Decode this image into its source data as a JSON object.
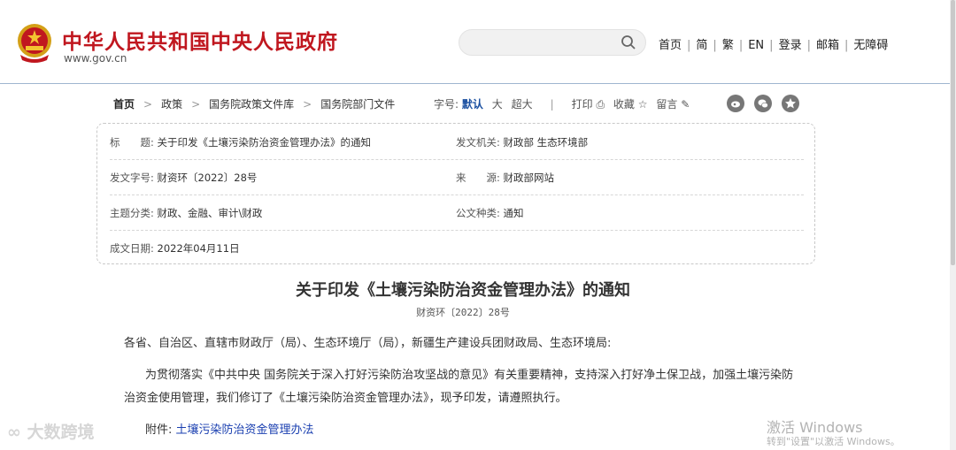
{
  "header": {
    "site_title": "中华人民共和国中央人民政府",
    "site_url": "www.gov.cn",
    "search_placeholder": "",
    "nav": [
      "首页",
      "简",
      "繁",
      "EN",
      "登录",
      "邮箱",
      "无障碍"
    ]
  },
  "breadcrumb": [
    "首页",
    "政策",
    "国务院政策文件库",
    "国务院部门文件"
  ],
  "tools": {
    "font_label": "字号:",
    "font_default": "默认",
    "font_large": "大",
    "font_xlarge": "超大",
    "print": "打印",
    "favorite": "收藏",
    "comment": "留言"
  },
  "info": {
    "title_label": "标　　题:",
    "title_value": "关于印发《土壤污染防治资金管理办法》的通知",
    "issuer_label": "发文机关:",
    "issuer_value": "财政部 生态环境部",
    "docno_label": "发文字号:",
    "docno_value": "财资环〔2022〕28号",
    "source_label": "来　　源:",
    "source_value": "财政部网站",
    "topic_label": "主题分类:",
    "topic_value": "财政、金融、审计\\财政",
    "type_label": "公文种类:",
    "type_value": "通知",
    "date_label": "成文日期:",
    "date_value": "2022年04月11日"
  },
  "document": {
    "title": "关于印发《土壤污染防治资金管理办法》的通知",
    "number": "财资环〔2022〕28号",
    "recipients": "各省、自治区、直辖市财政厅（局）、生态环境厅（局），新疆生产建设兵团财政局、生态环境局:",
    "body_line1": "为贯彻落实《中共中央 国务院关于深入打好污染防治攻坚战的意见》有关重要精神，支持深入打好净土保卫战，加强土壤污染防",
    "body_line2": "治资金使用管理，我们修订了《土壤污染防治资金管理办法》，现予印发，请遵照执行。",
    "attachment_label": "附件:",
    "attachment_link": "土壤污染防治资金管理办法"
  },
  "overlay": {
    "watermark": "大数跨境",
    "activate_title": "激活 Windows",
    "activate_sub": "转到\"设置\"以激活 Windows。"
  },
  "colors": {
    "brand_red": "#c0171f",
    "link_blue": "#1a3fb0"
  }
}
